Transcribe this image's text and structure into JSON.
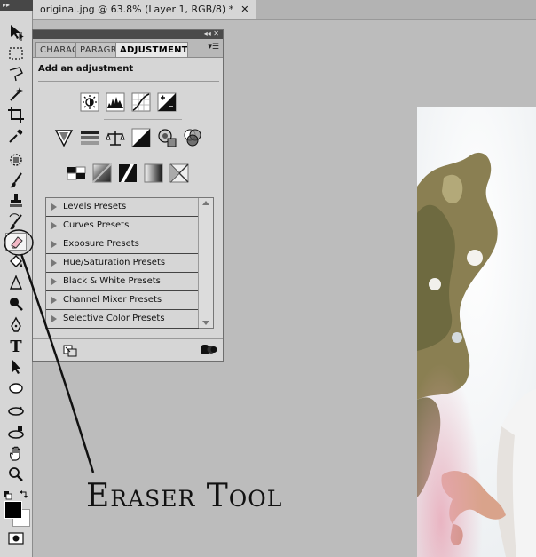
{
  "document": {
    "tab_title": "original.jpg @ 63.8% (Layer 1, RGB/8) *",
    "close_glyph": "✕"
  },
  "toolbar": {
    "tools": [
      "move-tool-icon",
      "marquee-tool-icon",
      "lasso-tool-icon",
      "magic-wand-tool-icon",
      "crop-tool-icon",
      "eyedropper-tool-icon",
      "spot-healing-tool-icon",
      "brush-tool-icon",
      "clone-stamp-tool-icon",
      "history-brush-tool-icon",
      "eraser-tool-icon",
      "paint-bucket-tool-icon",
      "blur-tool-icon",
      "dodge-tool-icon",
      "pen-tool-icon",
      "type-tool-icon",
      "path-selection-tool-icon",
      "ellipse-tool-icon",
      "3d-rotate-tool-icon",
      "3d-orbit-tool-icon",
      "hand-tool-icon",
      "zoom-tool-icon"
    ],
    "highlighted_tool": "eraser-tool-icon",
    "type_glyph": "T",
    "foreground_color": "#000000",
    "background_color": "#ffffff"
  },
  "panel": {
    "tabs": [
      "CHARACTER",
      "PARAGRAPH",
      "ADJUSTMENTS"
    ],
    "active_tab": "ADJUSTMENTS",
    "heading": "Add an adjustment",
    "menu_glyph": "▾☰",
    "titlebar_glyphs": "◂◂ ✕",
    "adjustment_rows": [
      [
        "brightness-contrast-icon",
        "levels-icon",
        "curves-icon",
        "exposure-icon"
      ],
      [
        "vibrance-icon",
        "hue-saturation-icon",
        "color-balance-icon",
        "black-white-icon",
        "photo-filter-icon",
        "channel-mixer-icon"
      ],
      [
        "invert-icon",
        "posterize-icon",
        "threshold-icon",
        "gradient-map-icon",
        "selective-color-icon"
      ]
    ],
    "presets": [
      "Levels Presets",
      "Curves Presets",
      "Exposure Presets",
      "Hue/Saturation Presets",
      "Black & White Presets",
      "Channel Mixer Presets",
      "Selective Color Presets"
    ]
  },
  "annotation": {
    "label": "Eraser Tool"
  },
  "colors": {
    "canvas": "#bcbcbc",
    "panel": "#d6d6d6",
    "titlebar": "#4a4a4a"
  }
}
